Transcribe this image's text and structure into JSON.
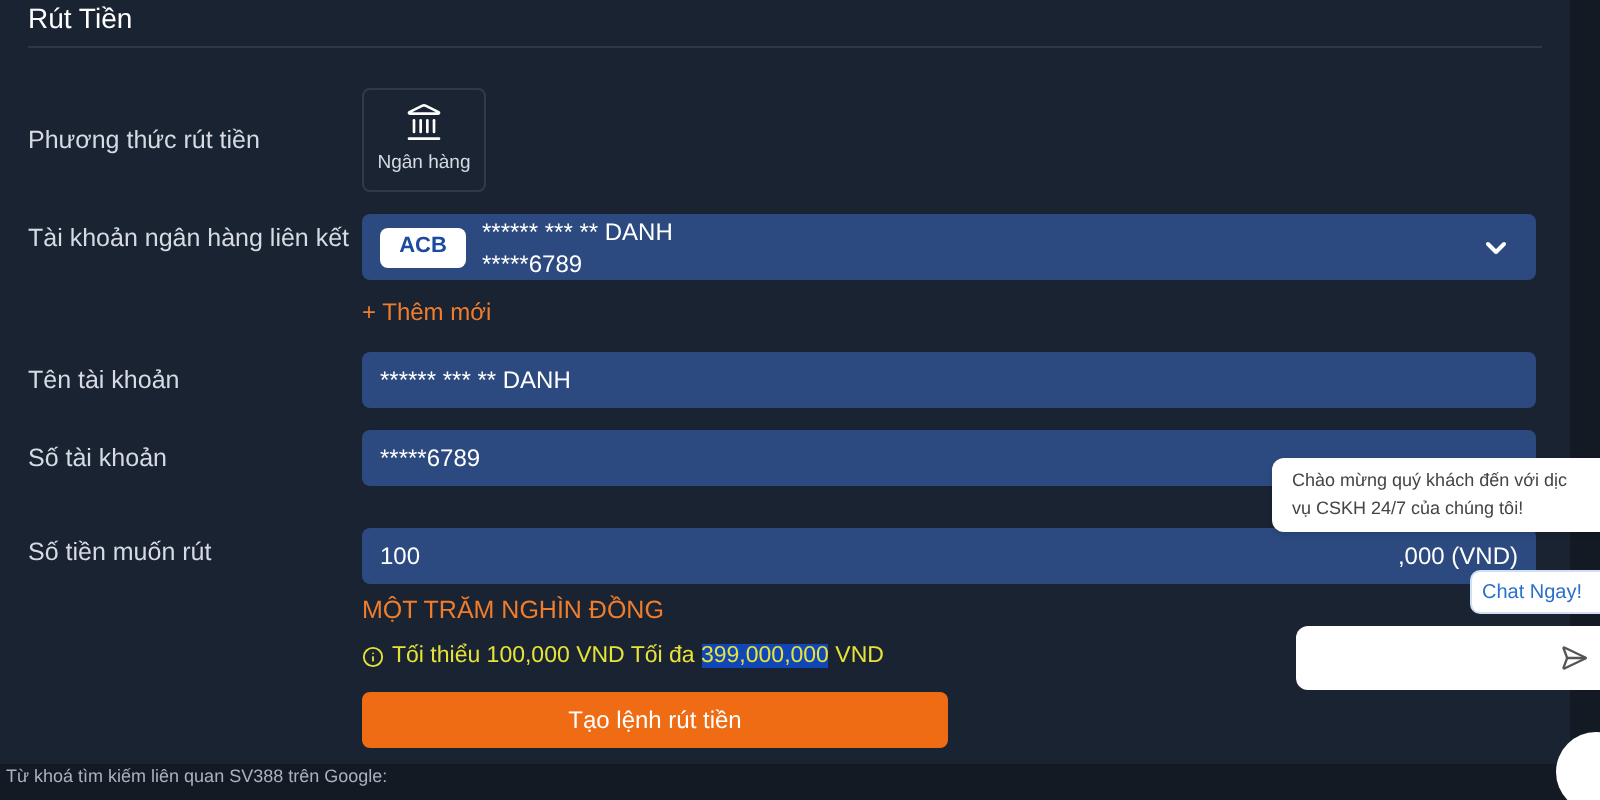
{
  "page": {
    "title": "Rút Tiền"
  },
  "form": {
    "method": {
      "label": "Phương thức rút tiền",
      "options": [
        {
          "label": "Ngân hàng",
          "selected": true
        }
      ]
    },
    "linked_account": {
      "label": "Tài khoản ngân hàng liên kết",
      "bank": "ACB",
      "name": "****** *** ** DANH",
      "number": "*****6789",
      "add_new": "+ Thêm mới"
    },
    "account_name": {
      "label": "Tên tài khoản",
      "value": "****** *** ** DANH"
    },
    "account_number": {
      "label": "Số tài khoản",
      "value": "*****6789"
    },
    "amount": {
      "label": "Số tiền muốn rút",
      "value": "100",
      "suffix": ",000 (VND)",
      "in_words": "MỘT TRĂM NGHÌN ĐỒNG",
      "hint_before": "Tối thiểu 100,000 VND Tối đa",
      "hint_max": "399,000,000",
      "hint_after": "VND"
    },
    "submit": "Tạo lệnh rút tiền"
  },
  "footer": {
    "text": "Từ khoá tìm kiếm liên quan SV388 trên Google:"
  },
  "chat": {
    "message_lines": [
      "Chào mừng quý khách đến với dịc",
      "vụ CSKH 24/7 của chúng tôi!"
    ],
    "button": "Chat Ngay!"
  }
}
